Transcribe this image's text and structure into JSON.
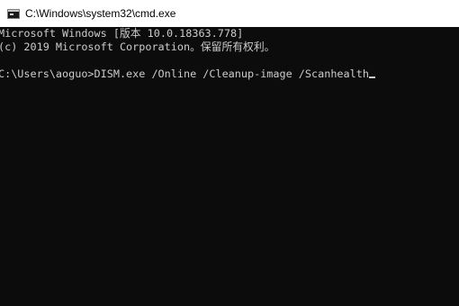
{
  "window": {
    "title": "C:\\Windows\\system32\\cmd.exe",
    "icon": "cmd-icon"
  },
  "console": {
    "lines": [
      "Microsoft Windows [版本 10.0.18363.778]",
      "(c) 2019 Microsoft Corporation。保留所有权利。",
      "",
      "C:\\Users\\aoguo>DISM.exe /Online /Cleanup-image /Scanhealth"
    ]
  },
  "colors": {
    "background": "#0c0c0c",
    "text": "#cccccc",
    "titlebar": "#ffffff"
  }
}
